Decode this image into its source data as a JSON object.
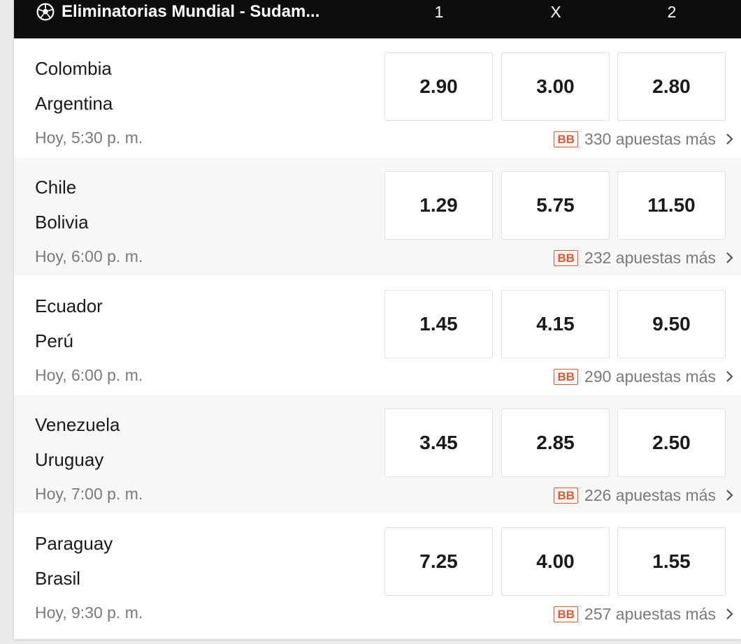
{
  "header": {
    "title": "Eliminatorias Mundial - Sudam...",
    "col1": "1",
    "colx": "X",
    "col2": "2",
    "icon": "soccer-ball-icon"
  },
  "badge": "BB",
  "matches": [
    {
      "home": "Colombia",
      "away": "Argentina",
      "time": "Hoy,  5:30 p. m.",
      "odds": [
        "2.90",
        "3.00",
        "2.80"
      ],
      "more": "330 apuestas más"
    },
    {
      "home": "Chile",
      "away": "Bolivia",
      "time": "Hoy,  6:00 p. m.",
      "odds": [
        "1.29",
        "5.75",
        "11.50"
      ],
      "more": "232 apuestas más"
    },
    {
      "home": "Ecuador",
      "away": "Perú",
      "time": "Hoy,  6:00 p. m.",
      "odds": [
        "1.45",
        "4.15",
        "9.50"
      ],
      "more": "290 apuestas más"
    },
    {
      "home": "Venezuela",
      "away": "Uruguay",
      "time": "Hoy,  7:00 p. m.",
      "odds": [
        "3.45",
        "2.85",
        "2.50"
      ],
      "more": "226 apuestas más"
    },
    {
      "home": "Paraguay",
      "away": "Brasil",
      "time": "Hoy,  9:30 p. m.",
      "odds": [
        "7.25",
        "4.00",
        "1.55"
      ],
      "more": "257 apuestas más"
    }
  ],
  "colors": {
    "header_bg": "#0d0d0d",
    "badge": "#e8542b",
    "alt_row": "#f7f7f7"
  }
}
